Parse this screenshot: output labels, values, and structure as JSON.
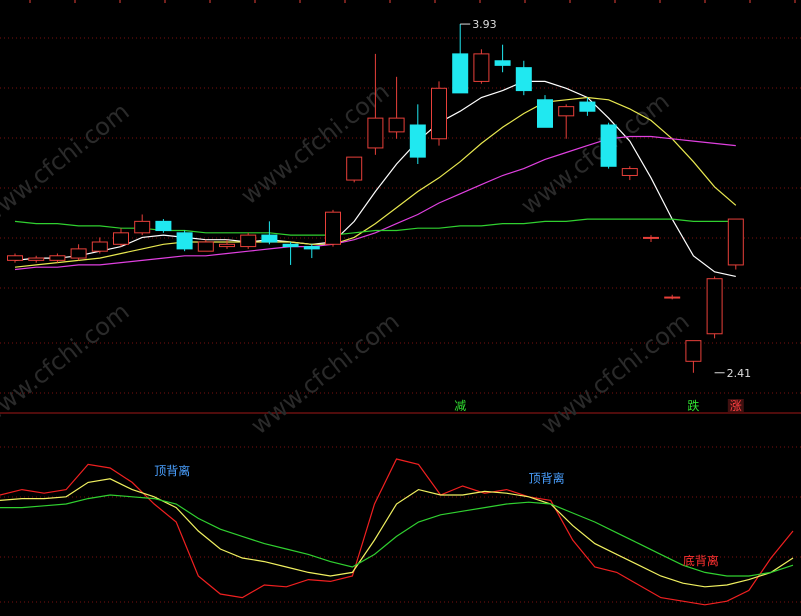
{
  "colors": {
    "background": "#000000",
    "up": "#e8403a",
    "down": "#20e8f0",
    "grid": "#7a1010",
    "ma5": "#ffffff",
    "ma10": "#e8e850",
    "ma20": "#e040e0",
    "ma60": "#30d030",
    "osc_fast": "#f02020",
    "osc_mid": "#f0f060",
    "osc_slow": "#30d030",
    "divergence_top": "#4aa0ff",
    "divergence_bottom": "#ff3030",
    "label_green": "#30e030",
    "label_red": "#ff4040",
    "watermark": "#2a2a2a"
  },
  "watermark": "www.cfchi.com",
  "chart_data": [
    {
      "type": "candlestick",
      "ylim": [
        2.3,
        4.0
      ],
      "annotations": [
        {
          "text": "3.93",
          "index": 21,
          "value": 3.93,
          "kind": "high"
        },
        {
          "text": "2.41",
          "index": 33,
          "value": 2.41,
          "kind": "low"
        }
      ],
      "signals": [
        {
          "text": "减",
          "index": 21,
          "color": "label_green"
        },
        {
          "text": "跌",
          "index": 32,
          "color": "label_green"
        },
        {
          "text": "涨",
          "index": 34,
          "color": "label_red"
        }
      ],
      "candles": [
        {
          "o": 2.9,
          "h": 2.93,
          "l": 2.89,
          "c": 2.92
        },
        {
          "o": 2.9,
          "h": 2.92,
          "l": 2.89,
          "c": 2.91
        },
        {
          "o": 2.9,
          "h": 2.93,
          "l": 2.89,
          "c": 2.92
        },
        {
          "o": 2.91,
          "h": 2.97,
          "l": 2.9,
          "c": 2.95
        },
        {
          "o": 2.94,
          "h": 3.0,
          "l": 2.93,
          "c": 2.98
        },
        {
          "o": 2.97,
          "h": 3.04,
          "l": 2.96,
          "c": 3.02
        },
        {
          "o": 3.02,
          "h": 3.1,
          "l": 3.01,
          "c": 3.07
        },
        {
          "o": 3.07,
          "h": 3.08,
          "l": 3.02,
          "c": 3.03
        },
        {
          "o": 3.02,
          "h": 3.03,
          "l": 2.94,
          "c": 2.95
        },
        {
          "o": 2.94,
          "h": 2.99,
          "l": 2.94,
          "c": 2.98
        },
        {
          "o": 2.96,
          "h": 2.99,
          "l": 2.95,
          "c": 2.97
        },
        {
          "o": 2.96,
          "h": 3.02,
          "l": 2.95,
          "c": 3.01
        },
        {
          "o": 3.01,
          "h": 3.07,
          "l": 2.97,
          "c": 2.98
        },
        {
          "o": 2.97,
          "h": 2.98,
          "l": 2.88,
          "c": 2.96
        },
        {
          "o": 2.96,
          "h": 2.97,
          "l": 2.91,
          "c": 2.95
        },
        {
          "o": 2.97,
          "h": 3.12,
          "l": 2.96,
          "c": 3.11
        },
        {
          "o": 3.25,
          "h": 3.35,
          "l": 3.24,
          "c": 3.35
        },
        {
          "o": 3.39,
          "h": 3.8,
          "l": 3.36,
          "c": 3.52
        },
        {
          "o": 3.46,
          "h": 3.7,
          "l": 3.43,
          "c": 3.52
        },
        {
          "o": 3.49,
          "h": 3.58,
          "l": 3.32,
          "c": 3.35
        },
        {
          "o": 3.43,
          "h": 3.68,
          "l": 3.4,
          "c": 3.65
        },
        {
          "o": 3.8,
          "h": 3.93,
          "l": 3.63,
          "c": 3.63
        },
        {
          "o": 3.68,
          "h": 3.82,
          "l": 3.67,
          "c": 3.8
        },
        {
          "o": 3.77,
          "h": 3.84,
          "l": 3.72,
          "c": 3.75
        },
        {
          "o": 3.74,
          "h": 3.77,
          "l": 3.62,
          "c": 3.64
        },
        {
          "o": 3.6,
          "h": 3.62,
          "l": 3.49,
          "c": 3.48
        },
        {
          "o": 3.53,
          "h": 3.58,
          "l": 3.43,
          "c": 3.57
        },
        {
          "o": 3.59,
          "h": 3.61,
          "l": 3.53,
          "c": 3.55
        },
        {
          "o": 3.49,
          "h": 3.5,
          "l": 3.3,
          "c": 3.31
        },
        {
          "o": 3.27,
          "h": 3.31,
          "l": 3.25,
          "c": 3.3
        },
        {
          "o": 3.0,
          "h": 3.01,
          "l": 2.98,
          "c": 3.0
        },
        {
          "o": 2.74,
          "h": 2.75,
          "l": 2.73,
          "c": 2.74
        },
        {
          "o": 2.46,
          "h": 2.55,
          "l": 2.41,
          "c": 2.55
        },
        {
          "o": 2.58,
          "h": 2.83,
          "l": 2.56,
          "c": 2.82
        },
        {
          "o": 2.88,
          "h": 3.08,
          "l": 2.86,
          "c": 3.08
        }
      ],
      "series": [
        {
          "key": "ma5",
          "values": [
            2.9,
            2.91,
            2.91,
            2.92,
            2.94,
            2.96,
            3.0,
            3.01,
            3.0,
            2.99,
            2.99,
            2.98,
            2.99,
            2.98,
            2.97,
            2.98,
            3.07,
            3.2,
            3.32,
            3.42,
            3.5,
            3.55,
            3.61,
            3.64,
            3.68,
            3.68,
            3.65,
            3.61,
            3.52,
            3.42,
            3.26,
            3.08,
            2.92,
            2.85,
            2.83
          ]
        },
        {
          "key": "ma10",
          "values": [
            2.87,
            2.88,
            2.89,
            2.9,
            2.91,
            2.93,
            2.95,
            2.97,
            2.98,
            2.98,
            2.98,
            2.98,
            2.98,
            2.98,
            2.97,
            2.97,
            3.0,
            3.06,
            3.13,
            3.2,
            3.26,
            3.33,
            3.41,
            3.48,
            3.54,
            3.59,
            3.6,
            3.61,
            3.6,
            3.56,
            3.51,
            3.43,
            3.33,
            3.22,
            3.14
          ]
        },
        {
          "key": "ma20",
          "values": [
            2.86,
            2.87,
            2.87,
            2.88,
            2.88,
            2.89,
            2.9,
            2.91,
            2.92,
            2.92,
            2.93,
            2.94,
            2.95,
            2.96,
            2.96,
            2.97,
            2.99,
            3.02,
            3.06,
            3.1,
            3.15,
            3.19,
            3.23,
            3.27,
            3.3,
            3.34,
            3.37,
            3.4,
            3.43,
            3.44,
            3.44,
            3.43,
            3.42,
            3.41,
            3.4
          ]
        },
        {
          "key": "ma60",
          "values": [
            3.07,
            3.06,
            3.06,
            3.05,
            3.05,
            3.04,
            3.04,
            3.03,
            3.03,
            3.02,
            3.02,
            3.02,
            3.02,
            3.01,
            3.01,
            3.01,
            3.02,
            3.03,
            3.03,
            3.04,
            3.04,
            3.05,
            3.05,
            3.06,
            3.06,
            3.07,
            3.07,
            3.08,
            3.08,
            3.08,
            3.08,
            3.08,
            3.07,
            3.07,
            3.07
          ]
        }
      ]
    },
    {
      "type": "line",
      "ylim": [
        0,
        100
      ],
      "series": [
        {
          "key": "osc_fast",
          "values": [
            65,
            68,
            66,
            68,
            82,
            80,
            72,
            60,
            50,
            20,
            10,
            8,
            15,
            14,
            18,
            17,
            20,
            60,
            85,
            82,
            65,
            70,
            66,
            68,
            64,
            62,
            40,
            25,
            22,
            15,
            8,
            6,
            4,
            6,
            12,
            30,
            45
          ]
        },
        {
          "key": "osc_mid",
          "values": [
            62,
            63,
            63,
            64,
            72,
            74,
            68,
            64,
            58,
            45,
            35,
            30,
            28,
            25,
            22,
            20,
            22,
            40,
            60,
            68,
            65,
            65,
            67,
            66,
            64,
            60,
            48,
            38,
            32,
            26,
            20,
            16,
            14,
            15,
            18,
            22,
            30
          ]
        },
        {
          "key": "osc_slow",
          "values": [
            58,
            58,
            59,
            60,
            63,
            65,
            64,
            63,
            60,
            52,
            46,
            42,
            38,
            35,
            32,
            28,
            25,
            32,
            42,
            50,
            54,
            56,
            58,
            60,
            61,
            60,
            55,
            50,
            44,
            38,
            32,
            26,
            22,
            20,
            20,
            22,
            26
          ]
        }
      ],
      "annotations": [
        {
          "text": "顶背离",
          "index": 7,
          "value": 76,
          "color": "divergence_top"
        },
        {
          "text": "顶背离",
          "index": 24,
          "value": 72,
          "color": "divergence_top"
        },
        {
          "text": "底背离",
          "index": 31,
          "value": 26,
          "color": "divergence_bottom"
        }
      ]
    }
  ]
}
